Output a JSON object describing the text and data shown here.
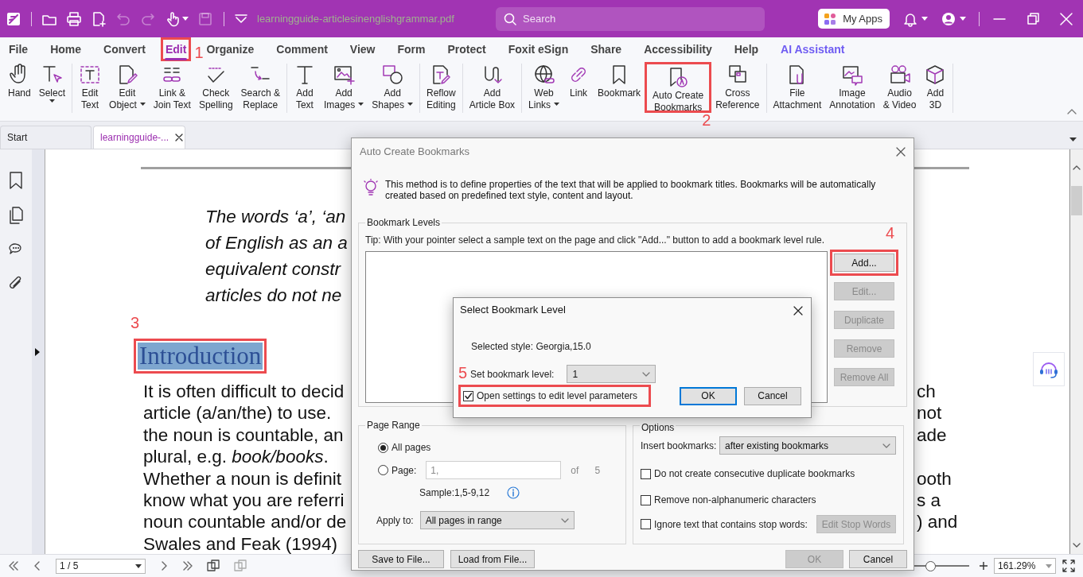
{
  "title_bar": {
    "quick_tools": [
      {
        "disabled": false
      },
      {
        "disabled": false
      },
      {
        "disabled": false
      },
      {
        "disabled": true
      },
      {
        "disabled": true
      },
      {
        "disabled": false
      },
      {
        "disabled": true
      }
    ],
    "file_name": "learningguide-articlesinenglishgrammar.pdf",
    "search": {
      "placeholder": "Search"
    },
    "apps_button": "My Apps"
  },
  "menu_tabs": [
    {
      "label": "File",
      "selected": false,
      "kind": "menu"
    },
    {
      "label": "Home",
      "selected": false,
      "kind": "menu"
    },
    {
      "label": "Convert",
      "selected": false,
      "kind": "menu"
    },
    {
      "label": "Edit",
      "selected": true,
      "kind": "menu",
      "callout": "1"
    },
    {
      "label": "Organize",
      "selected": false,
      "kind": "menu"
    },
    {
      "label": "Comment",
      "selected": false,
      "kind": "menu"
    },
    {
      "label": "View",
      "selected": false,
      "kind": "menu"
    },
    {
      "label": "Form",
      "selected": false,
      "kind": "menu"
    },
    {
      "label": "Protect",
      "selected": false,
      "kind": "menu"
    },
    {
      "label": "Foxit eSign",
      "selected": false,
      "kind": "menu"
    },
    {
      "label": "Share",
      "selected": false,
      "kind": "menu"
    },
    {
      "label": "Accessibility",
      "selected": false,
      "kind": "menu"
    },
    {
      "label": "Help",
      "selected": false,
      "kind": "menu"
    },
    {
      "label": "AI Assistant",
      "selected": false,
      "kind": "ai"
    }
  ],
  "ribbon": {
    "groups": [
      {
        "tools": [
          {
            "lines": [
              "Hand"
            ],
            "dropdown": false
          },
          {
            "lines": [
              "Select"
            ],
            "dropdown": true
          }
        ]
      },
      {
        "tools": [
          {
            "lines": [
              "Edit",
              "Text"
            ],
            "dropdown": false
          },
          {
            "lines": [
              "Edit",
              "Object"
            ],
            "dropdown": true
          },
          {
            "lines": [
              "Link &",
              "Join Text"
            ],
            "dropdown": false
          },
          {
            "lines": [
              "Check",
              "Spelling"
            ],
            "dropdown": false
          },
          {
            "lines": [
              "Search &",
              "Replace"
            ],
            "dropdown": false
          }
        ]
      },
      {
        "tools": [
          {
            "lines": [
              "Add",
              "Text"
            ],
            "dropdown": false
          },
          {
            "lines": [
              "Add",
              "Images"
            ],
            "dropdown": true
          },
          {
            "lines": [
              "Add",
              "Shapes"
            ],
            "dropdown": true
          }
        ]
      },
      {
        "tools": [
          {
            "lines": [
              "Reflow",
              "Editing"
            ],
            "dropdown": false
          }
        ]
      },
      {
        "tools": [
          {
            "lines": [
              "Add",
              "Article Box"
            ],
            "dropdown": false
          }
        ]
      },
      {
        "tools": [
          {
            "lines": [
              "Web",
              "Links"
            ],
            "dropdown": true
          },
          {
            "lines": [
              "Link"
            ],
            "dropdown": false
          },
          {
            "lines": [
              "Bookmark"
            ],
            "dropdown": false
          },
          {
            "lines": [
              "Auto Create",
              "Bookmarks"
            ],
            "dropdown": false,
            "callout": "2"
          },
          {
            "lines": [
              "Cross",
              "Reference"
            ],
            "dropdown": false
          }
        ]
      },
      {
        "tools": [
          {
            "lines": [
              "File",
              "Attachment"
            ],
            "dropdown": false
          },
          {
            "lines": [
              "Image",
              "Annotation"
            ],
            "dropdown": false
          },
          {
            "lines": [
              "Audio",
              "& Video"
            ],
            "dropdown": false
          },
          {
            "lines": [
              "Add",
              "3D"
            ],
            "dropdown": false
          }
        ]
      }
    ]
  },
  "doc_tabs": [
    {
      "label": "Start",
      "selected": false,
      "closable": false
    },
    {
      "label": "learningguide-...",
      "selected": true,
      "closable": true
    }
  ],
  "document": {
    "quote_lines": [
      "The words ‘a’, ‘an",
      "of English as an a",
      "equivalent constr",
      "articles do not ne"
    ],
    "heading": {
      "text": "Introduction",
      "highlighted": true,
      "callout": "3"
    },
    "body_lines": [
      {
        "left": "It is often difficult to decid",
        "right": "ch"
      },
      {
        "left": "article (a/an/the) to use.",
        "right": "not"
      },
      {
        "left": "the noun is countable, an",
        "right": "ade"
      },
      {
        "left": "plural, e.g. *book/books*."
      },
      {
        "left": "Whether a noun is definit",
        "right": "ooth"
      },
      {
        "left": "know what you are referri",
        "right": "s a"
      },
      {
        "left": "noun countable and/or de",
        "right": ") and"
      },
      {
        "left": "Swales and Feak (1994)"
      }
    ]
  },
  "dialog": {
    "title": "Auto Create Bookmarks",
    "intro": "This method is to define properties of the text that will be applied to bookmark titles. Bookmarks will be automatically created based on predefined text style, content and layout.",
    "levels": {
      "legend": "Bookmark Levels",
      "tip": "Tip: With your pointer select a sample text on the page and click \"Add...\" button to add a bookmark level rule.",
      "buttons": [
        {
          "label": "Add...",
          "disabled": false,
          "callout": "4"
        },
        {
          "label": "Edit...",
          "disabled": true
        },
        {
          "label": "Duplicate",
          "disabled": true
        },
        {
          "label": "Remove",
          "disabled": true
        },
        {
          "label": "Remove All",
          "disabled": true
        }
      ]
    },
    "page_range": {
      "legend": "Page Range",
      "choices": [
        {
          "label": "All pages",
          "selected": true
        },
        {
          "label": "Page:",
          "selected": false
        }
      ],
      "page_field": {
        "value": "1,",
        "disabled": true
      },
      "of_label": "of",
      "page_count": "5",
      "sample": "Sample:1,5-9,12",
      "apply_label": "Apply to:",
      "apply_value": "All pages in range"
    },
    "options": {
      "legend": "Options",
      "insert_label": "Insert bookmarks:",
      "insert_value": "after existing bookmarks",
      "checks": [
        {
          "label": "Do not create consecutive duplicate bookmarks",
          "checked": false
        },
        {
          "label": "Remove non-alphanumeric characters",
          "checked": false
        },
        {
          "label": "Ignore text that contains stop words:",
          "checked": false
        }
      ],
      "stop_words_button": {
        "label": "Edit Stop Words",
        "disabled": true
      }
    },
    "file_buttons": [
      {
        "label": "Save to File...",
        "disabled": false
      },
      {
        "label": "Load from File...",
        "disabled": false
      }
    ],
    "action_buttons": [
      {
        "label": "OK",
        "disabled": true
      },
      {
        "label": "Cancel",
        "disabled": false
      }
    ]
  },
  "sub_dialog": {
    "title": "Select Bookmark Level",
    "style_text": "Selected style: Georgia,15.0",
    "level_label": "Set bookmark level:",
    "level_value": "1",
    "open_settings": {
      "label": "Open settings to edit level parameters",
      "checked": true,
      "callout": "5"
    },
    "buttons": [
      {
        "label": "OK",
        "default": true
      },
      {
        "label": "Cancel",
        "default": false
      }
    ]
  },
  "status_bar": {
    "page_field": "1 / 5",
    "zoom": {
      "level": 0.3
    },
    "zoom_value": "161.29%"
  }
}
